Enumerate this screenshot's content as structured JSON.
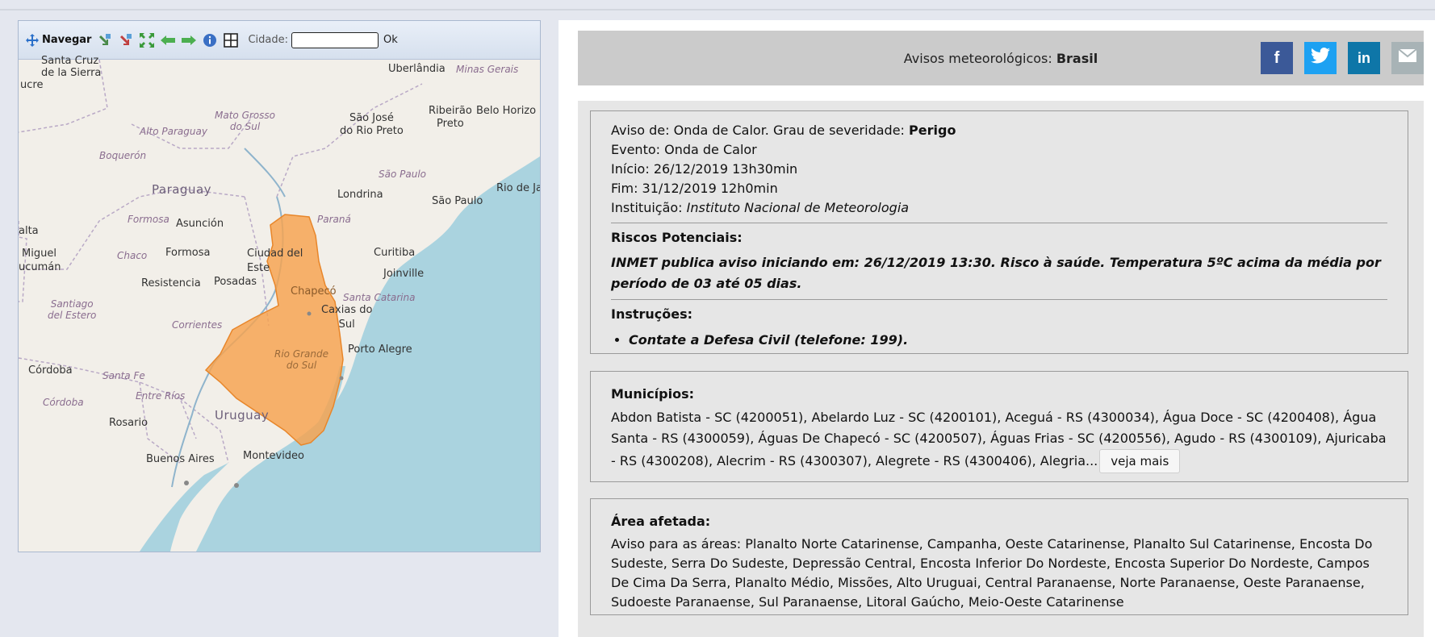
{
  "map": {
    "toolbar": {
      "navigate_label": "Navegar",
      "city_label": "Cidade:",
      "city_value": "",
      "ok_label": "Ok"
    },
    "labels": {
      "santa_cruz": "Santa Cruz\nde la Sierra",
      "sucre": "ucre",
      "uberlandia": "Uberlândia",
      "minas_gerais": "Minas Gerais",
      "belo_horizonte": "Belo Horizo",
      "mato_grosso_do_sul": "Mato Grosso\ndo Sul",
      "alto_paraguay": "Alto Paraguay",
      "sao_jose_rio_preto": "São José\ndo Rio Preto",
      "ribeirao_preto": "Ribeirão\nPreto",
      "boqueron": "Boquerón",
      "sao_paulo_state": "São Paulo",
      "paraguay": "Paraguay",
      "londrina": "Londrina",
      "sao_paulo": "São Paulo",
      "rio_de_ja": "Rio de Ja",
      "formosa_region": "Formosa",
      "asuncion": "Asunción",
      "parana": "Paraná",
      "alta": "alta",
      "miguel": "Miguel",
      "cucuman": "ucumán",
      "chaco": "Chaco",
      "formosa": "Formosa",
      "ciudad_del_este": "Ciudad del\nEste",
      "curitiba": "Curitiba",
      "joinville": "Joinville",
      "posadas": "Posadas",
      "resistencia": "Resistencia",
      "chapeco": "Chapecó",
      "santa_catarina": "Santa Catarina",
      "santiago_del_estero": "Santiago\ndel Estero",
      "caxias_do_sul": "Caxias do\nSul",
      "corrientes": "Corrientes",
      "porto_alegre": "Porto Alegre",
      "rio_grande_do_sul": "Rio Grande\ndo Sul",
      "cordoba_city": "Córdoba",
      "santa_fe": "Santa Fe",
      "entre_rios": "Entre Ríos",
      "cordoba_region": "Córdoba",
      "uruguay": "Uruguay",
      "rosario": "Rosario",
      "buenos_aires": "Buenos Aires",
      "montevideo": "Montevideo"
    },
    "colors": {
      "warning_area": "#f7a24e",
      "land": "#f2efe9",
      "sea": "#aad3df"
    }
  },
  "header": {
    "title_prefix": "Avisos meteorológicos:",
    "title_bold": "Brasil"
  },
  "share": {
    "facebook": "f",
    "twitter": "t",
    "linkedin": "in",
    "email": "✉"
  },
  "alert": {
    "aviso_prefix": "Aviso de: Onda de Calor. Grau de severidade:",
    "severity": "Perigo",
    "evento": "Evento: Onda de Calor",
    "inicio": "Início: 26/12/2019 13h30min",
    "fim": "Fim: 31/12/2019 12h0min",
    "instituicao_label": "Instituição:",
    "instituicao": "Instituto Nacional de Meteorologia",
    "riscos_title": "Riscos Potenciais:",
    "riscos_text": "INMET publica aviso iniciando em: 26/12/2019 13:30. Risco à saúde. Temperatura 5ºC acima da média por período de 03 até 05 dias.",
    "instrucoes_title": "Instruções:",
    "instrucoes": [
      "Contate a Defesa Civil (telefone: 199)."
    ]
  },
  "municipios": {
    "title": "Municípios:",
    "text": "Abdon Batista - SC (4200051), Abelardo Luz - SC (4200101), Aceguá - RS (4300034), Água Doce - SC (4200408), Água Santa - RS (4300059), Águas De Chapecó - SC (4200507), Águas Frias - SC (4200556), Agudo - RS (4300109), Ajuricaba - RS (4300208), Alecrim - RS (4300307), Alegrete - RS (4300406), Alegria...",
    "veja_mais": "veja mais"
  },
  "area": {
    "title": "Área afetada:",
    "text": "Aviso para as áreas: Planalto Norte Catarinense, Campanha, Oeste Catarinense, Planalto Sul Catarinense, Encosta Do Sudeste, Serra Do Sudeste, Depressão Central, Encosta Inferior Do Nordeste, Encosta Superior Do Nordeste, Campos De Cima Da Serra, Planalto Médio, Missões, Alto Uruguai, Central Paranaense, Norte Paranaense, Oeste Paranaense, Sudoeste Paranaense, Sul Paranaense, Litoral Gaúcho, Meio-Oeste Catarinense"
  }
}
